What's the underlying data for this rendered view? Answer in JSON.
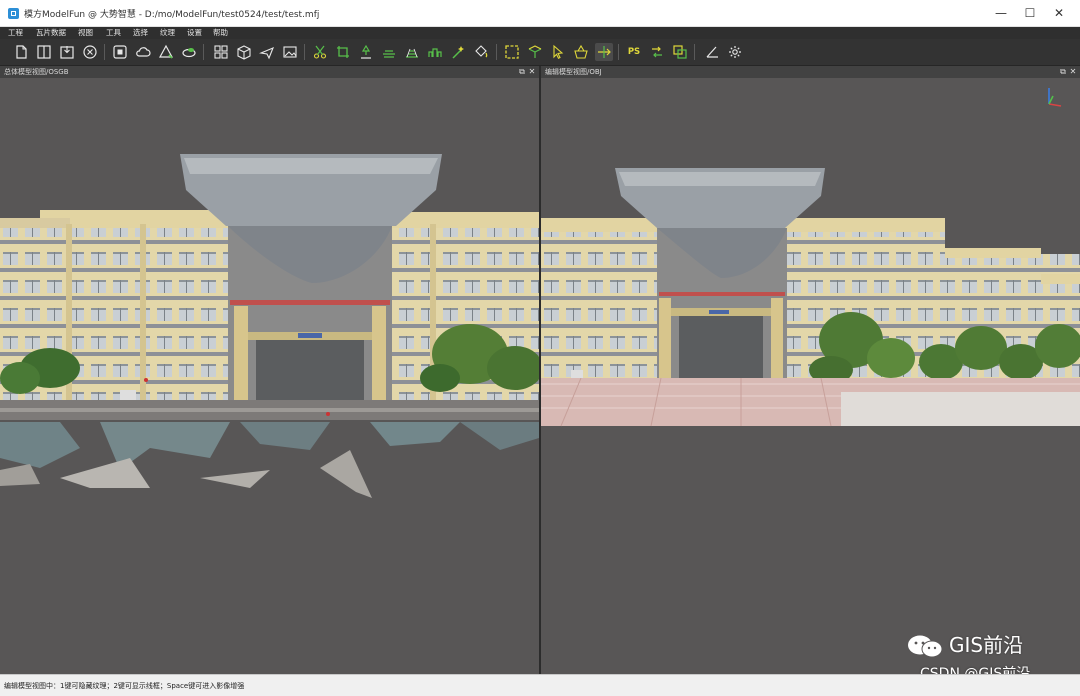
{
  "window": {
    "title": "模方ModelFun @ 大势智慧 - D:/mo/ModelFun/test0524/test/test.mfj",
    "minimize": "—",
    "maximize": "☐",
    "close": "✕"
  },
  "menu": [
    "工程",
    "瓦片数据",
    "视图",
    "工具",
    "选择",
    "纹理",
    "设置",
    "帮助"
  ],
  "toolbar": {
    "groups": [
      [
        "new-file-icon",
        "split-view-icon",
        "save-icon",
        "close-circle-icon"
      ],
      [
        "stop-icon",
        "cloud-icon",
        "triangle-icon",
        "layers-icon"
      ],
      [
        "grid-icon",
        "cube-icon",
        "plane-icon",
        "image-icon"
      ],
      [
        "scissors-icon",
        "crop-icon",
        "pin-icon",
        "flatten-icon",
        "road-icon",
        "bridge-icon",
        "magic-wand-icon",
        "bucket-icon"
      ],
      [
        "rectangle-select-icon",
        "ring-select-icon",
        "pointer-icon",
        "basket-icon",
        "move-icon"
      ],
      [
        "photoshop-icon",
        "transfer-icon",
        "copy-icon"
      ],
      [
        "angle-icon",
        "settings-icon"
      ]
    ],
    "ps_label": "PS",
    "accent": "#e0d83a",
    "green": "#58c04a"
  },
  "panels": {
    "left": {
      "title": "总体模型视图/OSGB"
    },
    "right": {
      "title": "编辑模型视图/OBJ"
    },
    "restore": "⧉",
    "close": "✕"
  },
  "status": {
    "text": "编辑模型视图中：1键可隐藏纹理；2键可显示线框；Space键可进入影像增强"
  },
  "watermark": {
    "main": "GIS前沿",
    "sub": "CSDN @GIS前沿"
  },
  "colors": {
    "viewport_bg": "#585656",
    "building_facade": "#e3d7a9",
    "window": "#cfd4d8",
    "tree": "#4f7a35",
    "plaza": "#d8b9b4"
  }
}
